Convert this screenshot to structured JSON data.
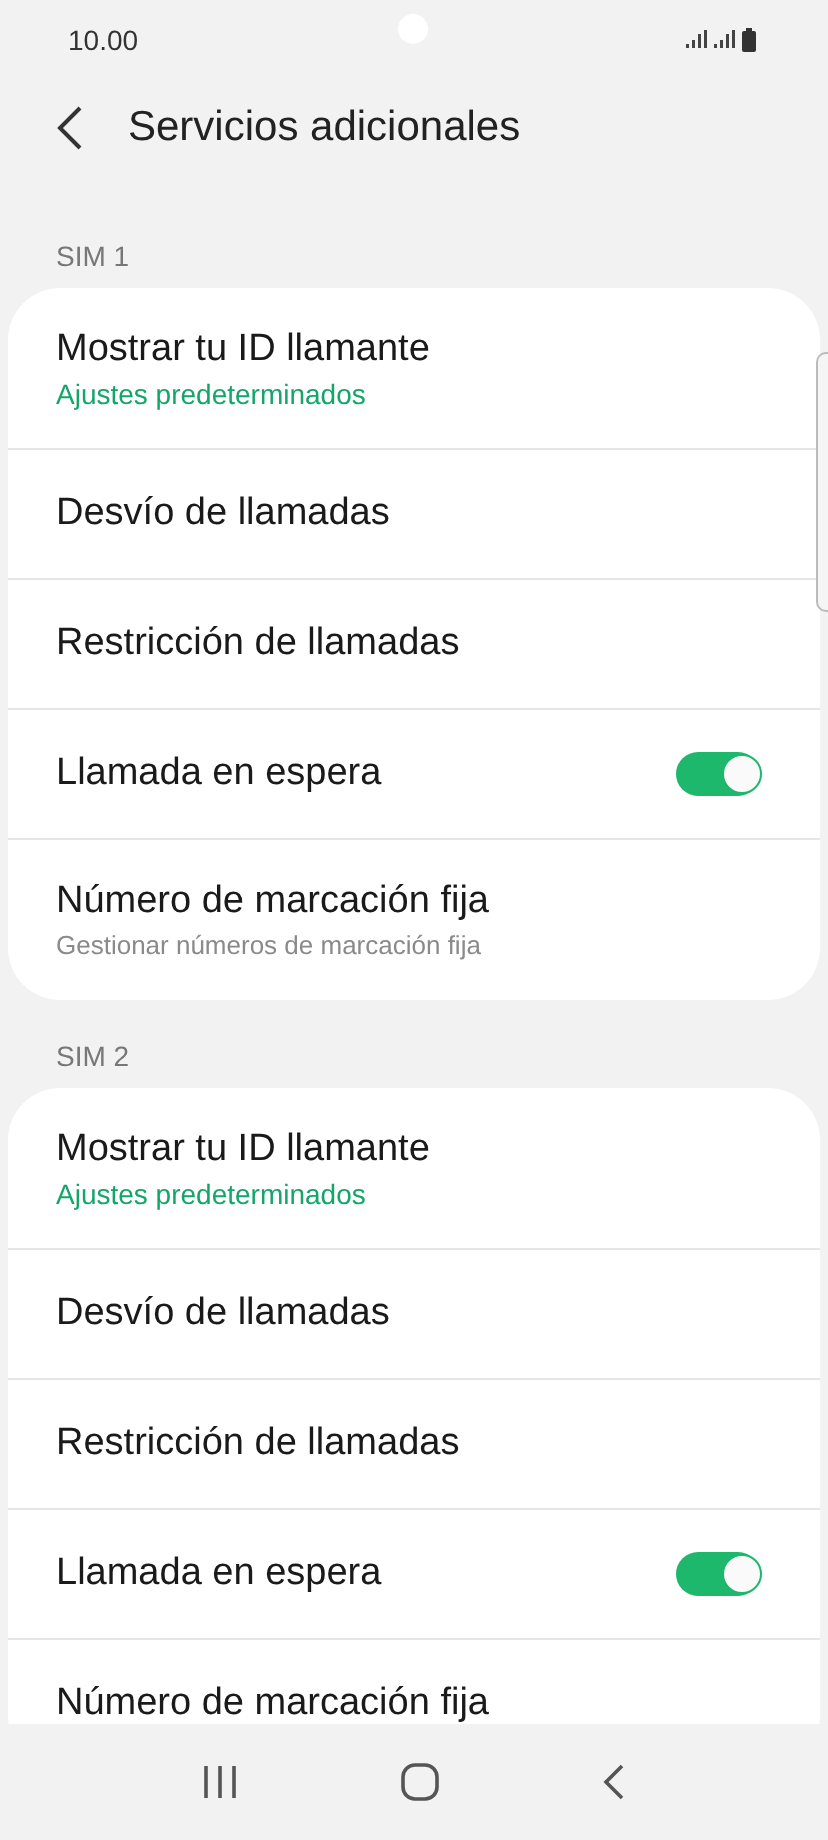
{
  "status_bar": {
    "time": "10.00"
  },
  "header": {
    "title": "Servicios adicionales"
  },
  "sections": [
    {
      "label": "SIM 1",
      "items": [
        {
          "kind": "subtitle",
          "title": "Mostrar tu ID llamante",
          "subtitle": "Ajustes predeterminados"
        },
        {
          "kind": "plain",
          "title": "Desvío de llamadas"
        },
        {
          "kind": "plain",
          "title": "Restricción de llamadas"
        },
        {
          "kind": "toggle",
          "title": "Llamada en espera",
          "on": true
        },
        {
          "kind": "note",
          "title": "Número de marcación fija",
          "subtitle": "Gestionar números de marcación fija"
        }
      ]
    },
    {
      "label": "SIM 2",
      "items": [
        {
          "kind": "subtitle",
          "title": "Mostrar tu ID llamante",
          "subtitle": "Ajustes predeterminados"
        },
        {
          "kind": "plain",
          "title": "Desvío de llamadas"
        },
        {
          "kind": "plain",
          "title": "Restricción de llamadas"
        },
        {
          "kind": "toggle",
          "title": "Llamada en espera",
          "on": true
        },
        {
          "kind": "plain",
          "title": "Número de marcación fija"
        }
      ]
    }
  ]
}
